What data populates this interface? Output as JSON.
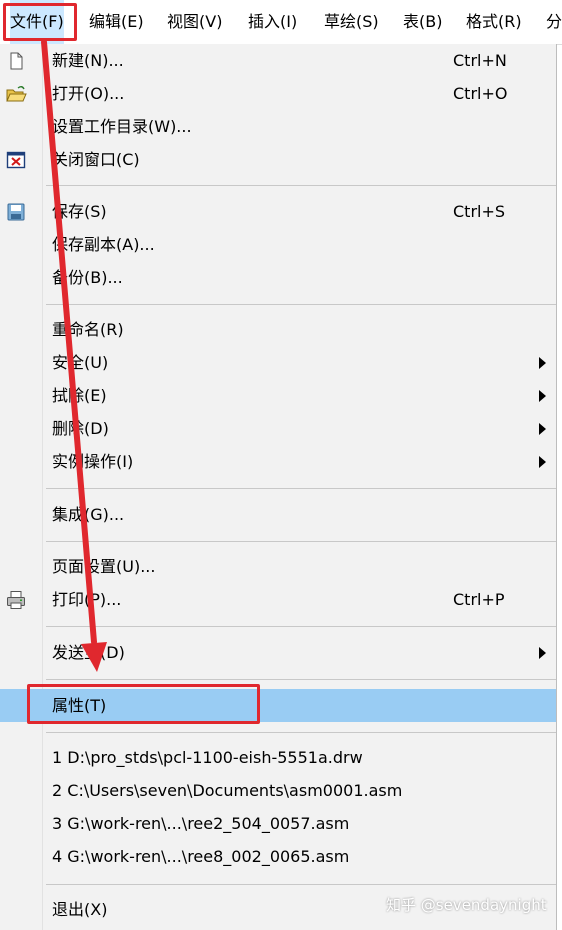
{
  "menubar": {
    "items": [
      "文件(F)",
      "编辑(E)",
      "视图(V)",
      "插入(I)",
      "草绘(S)",
      "表(B)",
      "格式(R)",
      "分"
    ]
  },
  "menu": {
    "items": [
      {
        "label": "新建(N)...",
        "shortcut": "Ctrl+N",
        "icon": "new-document-icon"
      },
      {
        "label": "打开(O)...",
        "shortcut": "Ctrl+O",
        "icon": "open-folder-icon"
      },
      {
        "label": "设置工作目录(W)..."
      },
      {
        "label": "关闭窗口(C)",
        "icon": "close-window-icon"
      },
      {
        "label": "保存(S)",
        "shortcut": "Ctrl+S",
        "icon": "save-disk-icon"
      },
      {
        "label": "保存副本(A)..."
      },
      {
        "label": "备份(B)..."
      },
      {
        "label": "重命名(R)"
      },
      {
        "label": "安全(U)",
        "submenu": true
      },
      {
        "label": "拭除(E)",
        "submenu": true
      },
      {
        "label": "删除(D)",
        "submenu": true
      },
      {
        "label": "实例操作(I)",
        "submenu": true
      },
      {
        "label": "集成(G)..."
      },
      {
        "label": "页面设置(U)..."
      },
      {
        "label": "打印(P)...",
        "shortcut": "Ctrl+P",
        "icon": "printer-icon"
      },
      {
        "label": "发送至(D)",
        "submenu": true
      },
      {
        "label": "属性(T)",
        "highlighted": true
      },
      {
        "label": "1 D:\\pro_stds\\pcl-1100-eish-5551a.drw"
      },
      {
        "label": "2 C:\\Users\\seven\\Documents\\asm0001.asm"
      },
      {
        "label": "3 G:\\work-ren\\...\\ree2_504_0057.asm"
      },
      {
        "label": "4 G:\\work-ren\\...\\ree8_002_0065.asm"
      },
      {
        "label": "退出(X)"
      }
    ]
  },
  "colors": {
    "highlight": "#99ccf3",
    "annotation_red": "#e0282e",
    "menubar_active": "#cce8ff"
  },
  "watermark": "知乎 @sevendaynight"
}
